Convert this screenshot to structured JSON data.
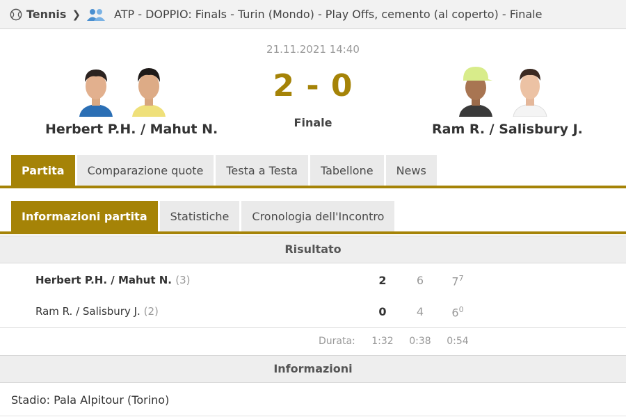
{
  "breadcrumb": {
    "sport": "Tennis",
    "league": "ATP - DOPPIO: Finals - Turin (Mondo) - Play Offs, cemento (al coperto) - Finale",
    "sport_icon": "tennis-ball-icon",
    "doubles_icon": "doubles-players-icon"
  },
  "match": {
    "datetime": "21.11.2021 14:40",
    "score": "2 - 0",
    "status": "Finale",
    "home_team": "Herbert P.H. / Mahut N.",
    "away_team": "Ram R. / Salisbury J."
  },
  "tabs": [
    "Partita",
    "Comparazione quote",
    "Testa a Testa",
    "Tabellone",
    "News"
  ],
  "subtabs": [
    "Informazioni partita",
    "Statistiche",
    "Cronologia dell'Incontro"
  ],
  "result": {
    "heading": "Risultato",
    "rows": [
      {
        "name": "Herbert P.H. / Mahut N.",
        "seed": "(3)",
        "total": "2",
        "set1": "6",
        "set2": "7",
        "set2_tb": "7"
      },
      {
        "name": "Ram R. / Salisbury J.",
        "seed": "(2)",
        "total": "0",
        "set1": "4",
        "set2": "6",
        "set2_tb": "0"
      }
    ],
    "duration_label": "Durata:",
    "duration_total": "1:32",
    "duration_set1": "0:38",
    "duration_set2": "0:54"
  },
  "info": {
    "heading": "Informazioni",
    "stadium": "Stadio: Pala Alpitour (Torino)"
  },
  "colors": {
    "accent": "#a58307",
    "tab_bg": "#eaeaea",
    "header_bg": "#f2f2f2"
  }
}
